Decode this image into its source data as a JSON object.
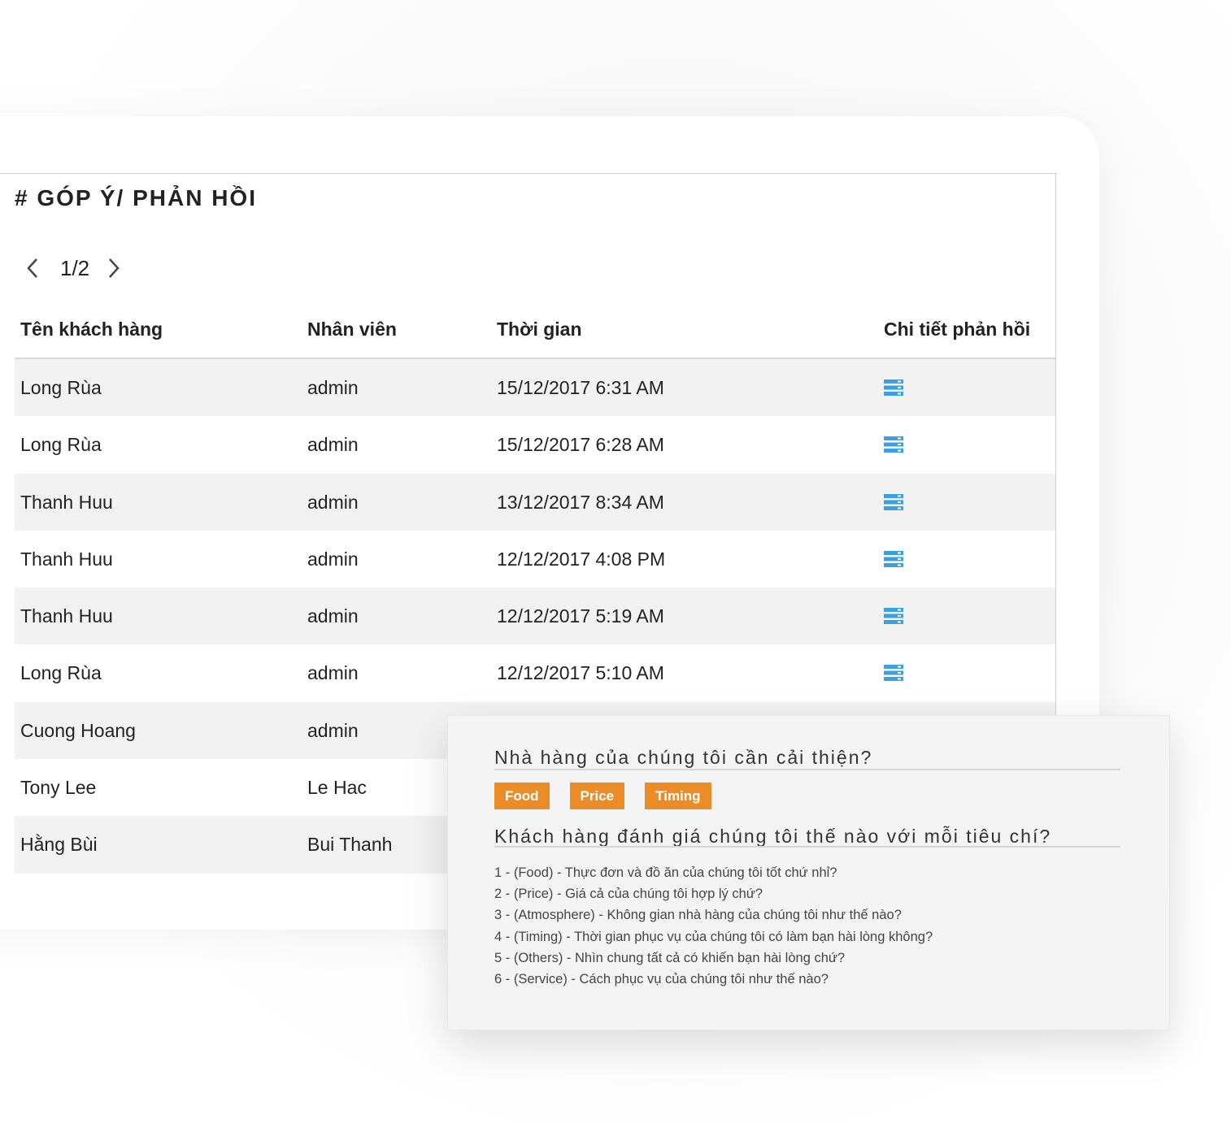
{
  "page": {
    "title": "# GÓP Ý/ PHẢN HỒI"
  },
  "pager": {
    "current": "1/2"
  },
  "table": {
    "headers": [
      "Tên khách hàng",
      "Nhân viên",
      "Thời gian",
      "Chi tiết phản hồi"
    ],
    "rows": [
      {
        "customer": "Long Rùa",
        "staff": "admin",
        "time": "15/12/2017 6:31 AM"
      },
      {
        "customer": "Long Rùa",
        "staff": "admin",
        "time": "15/12/2017 6:28 AM"
      },
      {
        "customer": "Thanh Huu",
        "staff": "admin",
        "time": "13/12/2017 8:34 AM"
      },
      {
        "customer": "Thanh Huu",
        "staff": "admin",
        "time": "12/12/2017 4:08 PM"
      },
      {
        "customer": "Thanh Huu",
        "staff": "admin",
        "time": "12/12/2017 5:19 AM"
      },
      {
        "customer": "Long Rùa",
        "staff": "admin",
        "time": "12/12/2017 5:10 AM"
      },
      {
        "customer": "Cuong Hoang",
        "staff": "admin",
        "time": ""
      },
      {
        "customer": "Tony Lee",
        "staff": "Le Hac",
        "time": ""
      },
      {
        "customer": "Hằng Bùi",
        "staff": "Bui Thanh",
        "time": ""
      }
    ]
  },
  "popup": {
    "improve_title": "Nhà hàng của chúng tôi cần cải thiện?",
    "tags": [
      "Food",
      "Price",
      "Timing"
    ],
    "rating_title": "Khách hàng đánh giá chúng tôi thế nào với mỗi tiêu chí?",
    "criteria": [
      "1 - (Food) - Thực đơn và đồ ăn của chúng tôi tốt chứ nhỉ?",
      "2 - (Price) - Giá cả của chúng tôi hợp lý chứ?",
      "3 - (Atmosphere) - Không gian nhà hàng của chúng tôi như thế nào?",
      "4 - (Timing) - Thời gian phục vụ của chúng tôi có làm bạn hài lòng không?",
      "5 - (Others) - Nhìn chung tất cả có khiến bạn hài lòng chứ?",
      "6 - (Service) - Cách phục vụ của chúng tôi như thế nào?"
    ]
  },
  "colors": {
    "accent": "#ec8c26",
    "icon": "#3aa0e0"
  }
}
